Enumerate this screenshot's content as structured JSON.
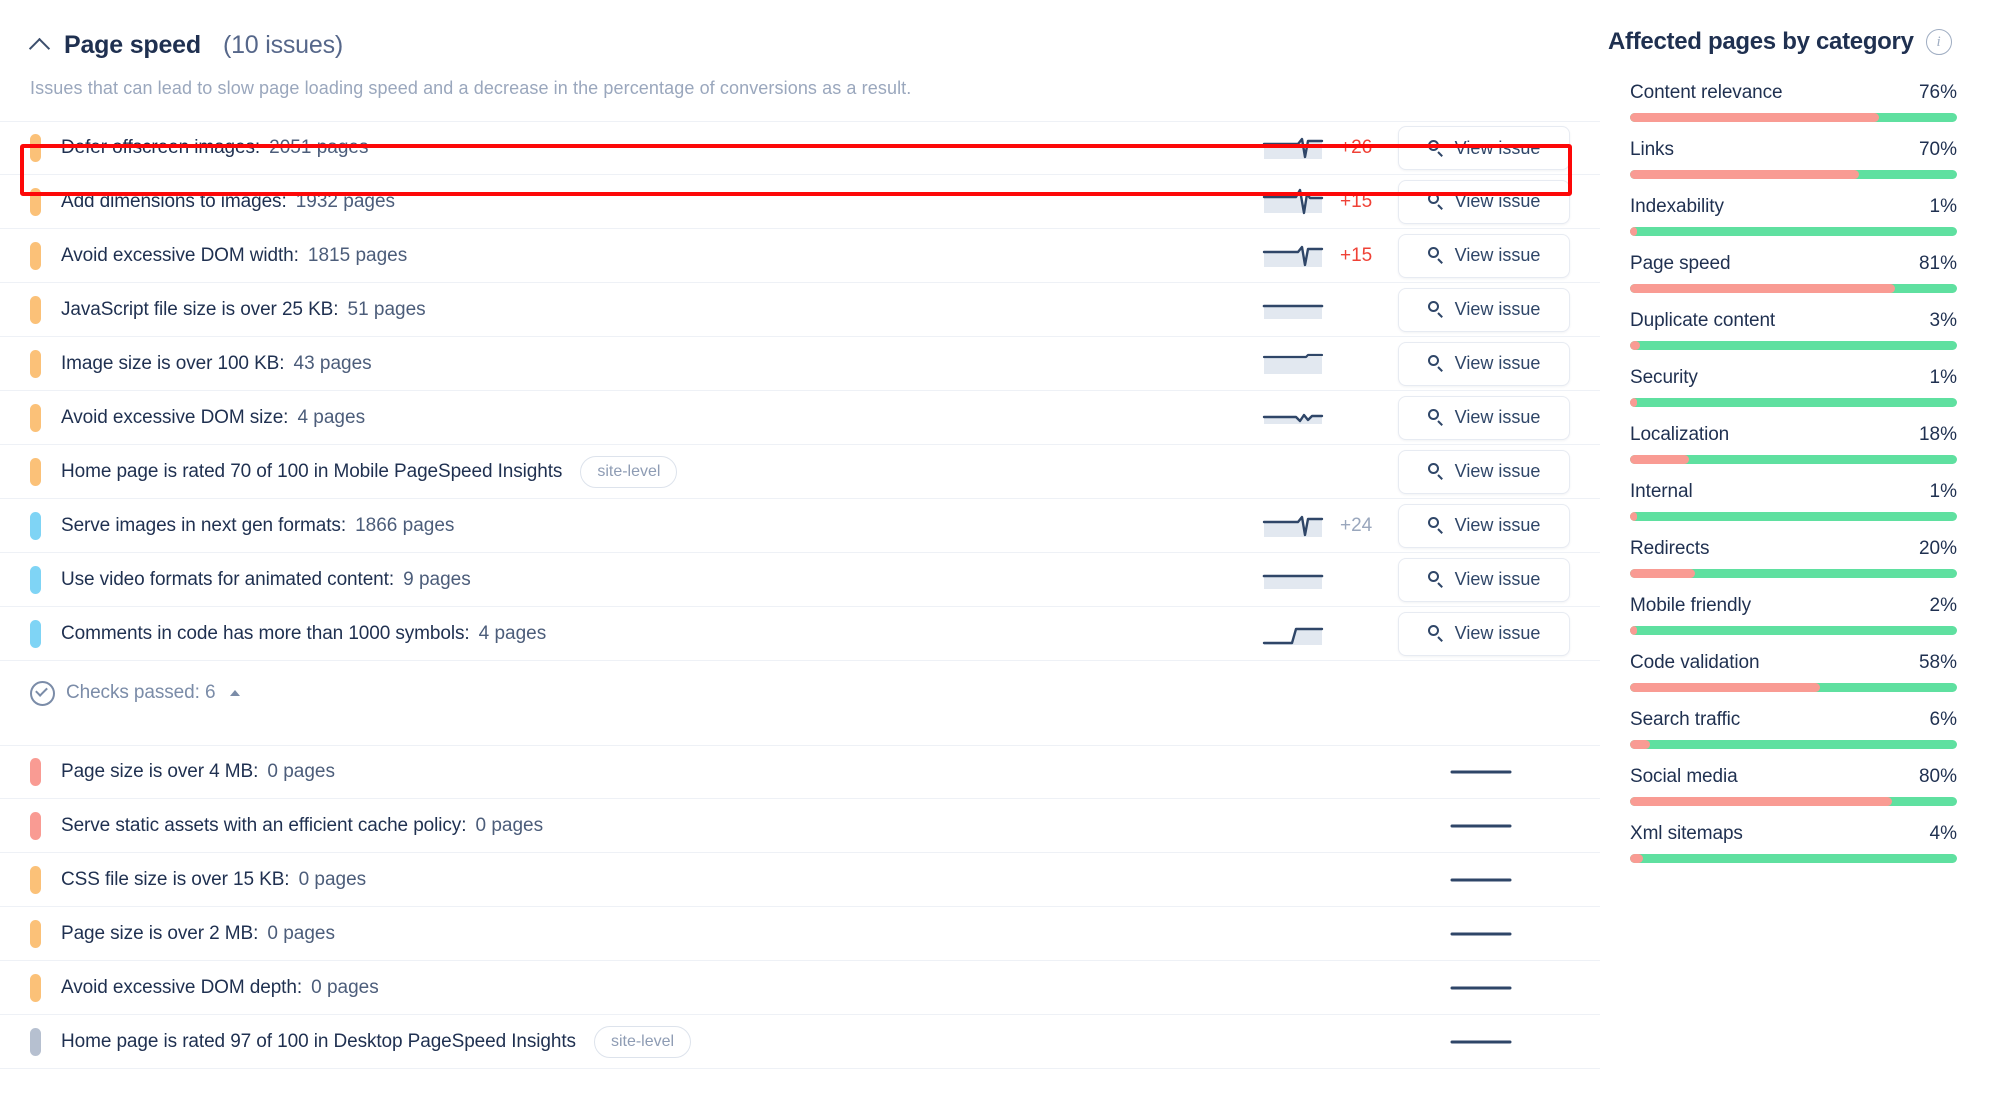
{
  "section": {
    "title": "Page speed",
    "count": "(10 issues)",
    "description": "Issues that can lead to slow page loading speed and a decrease in the percentage of conversions as a result.",
    "collapse_icon": "chevron-up-icon"
  },
  "view_issue_label": "View issue",
  "site_level_badge": "site-level",
  "issues": [
    {
      "severity": "warning",
      "label": "Defer offscreen images",
      "sep": ":",
      "count": "2051 pages",
      "badge": "",
      "spark": "dip",
      "delta": "+26",
      "delta_state": "up"
    },
    {
      "severity": "warning",
      "label": "Add dimensions to images",
      "sep": ":",
      "count": "1932 pages",
      "badge": "",
      "spark": "dip-tall",
      "delta": "+15",
      "delta_state": "up"
    },
    {
      "severity": "warning",
      "label": "Avoid excessive DOM width",
      "sep": ":",
      "count": "1815 pages",
      "badge": "",
      "spark": "dip",
      "delta": "+15",
      "delta_state": "up"
    },
    {
      "severity": "warning",
      "label": "JavaScript file size is over 25 KB",
      "sep": ":",
      "count": "51 pages",
      "badge": "",
      "spark": "flat-fill",
      "delta": "",
      "delta_state": ""
    },
    {
      "severity": "warning",
      "label": "Image size is over 100 KB",
      "sep": ":",
      "count": "43 pages",
      "badge": "",
      "spark": "block",
      "delta": "",
      "delta_state": ""
    },
    {
      "severity": "warning",
      "label": "Avoid excessive DOM size",
      "sep": ":",
      "count": "4 pages",
      "badge": "",
      "spark": "wave",
      "delta": "",
      "delta_state": ""
    },
    {
      "severity": "warning",
      "label": "Home page is rated 70 of 100 in Mobile PageSpeed Insights",
      "sep": "",
      "count": "",
      "badge": "site-level",
      "spark": "none",
      "delta": "",
      "delta_state": ""
    },
    {
      "severity": "notice",
      "label": "Serve images in next gen formats",
      "sep": ":",
      "count": "1866 pages",
      "badge": "",
      "spark": "dip",
      "delta": "+24",
      "delta_state": "flat"
    },
    {
      "severity": "notice",
      "label": "Use video formats for animated content",
      "sep": ":",
      "count": "9 pages",
      "badge": "",
      "spark": "flat-fill",
      "delta": "",
      "delta_state": ""
    },
    {
      "severity": "notice",
      "label": "Comments in code has more than 1000 symbols",
      "sep": ":",
      "count": "4 pages",
      "badge": "",
      "spark": "step",
      "delta": "",
      "delta_state": ""
    }
  ],
  "checks_passed": {
    "label": "Checks passed: 6",
    "icon": "check-circle-icon",
    "caret": "caret-up-icon",
    "items": [
      {
        "severity": "error",
        "label": "Page size is over 4 MB",
        "sep": ":",
        "count": "0 pages",
        "badge": ""
      },
      {
        "severity": "error",
        "label": "Serve static assets with an efficient cache policy",
        "sep": ":",
        "count": "0 pages",
        "badge": ""
      },
      {
        "severity": "warning",
        "label": "CSS file size is over 15 KB",
        "sep": ":",
        "count": "0 pages",
        "badge": ""
      },
      {
        "severity": "warning",
        "label": "Page size is over 2 MB",
        "sep": ":",
        "count": "0 pages",
        "badge": ""
      },
      {
        "severity": "warning",
        "label": "Avoid excessive DOM depth",
        "sep": ":",
        "count": "0 pages",
        "badge": ""
      },
      {
        "severity": "neutral",
        "label": "Home page is rated 97 of 100 in Desktop PageSpeed Insights",
        "sep": "",
        "count": "",
        "badge": "site-level"
      }
    ]
  },
  "affected": {
    "title": "Affected pages by category",
    "info_icon": "info-icon",
    "categories": [
      {
        "name": "Content relevance",
        "pct": "76%",
        "value": 76
      },
      {
        "name": "Links",
        "pct": "70%",
        "value": 70
      },
      {
        "name": "Indexability",
        "pct": "1%",
        "value": 1
      },
      {
        "name": "Page speed",
        "pct": "81%",
        "value": 81
      },
      {
        "name": "Duplicate content",
        "pct": "3%",
        "value": 3
      },
      {
        "name": "Security",
        "pct": "1%",
        "value": 1
      },
      {
        "name": "Localization",
        "pct": "18%",
        "value": 18
      },
      {
        "name": "Internal",
        "pct": "1%",
        "value": 1
      },
      {
        "name": "Redirects",
        "pct": "20%",
        "value": 20
      },
      {
        "name": "Mobile friendly",
        "pct": "2%",
        "value": 2
      },
      {
        "name": "Code validation",
        "pct": "58%",
        "value": 58
      },
      {
        "name": "Search traffic",
        "pct": "6%",
        "value": 6
      },
      {
        "name": "Social media",
        "pct": "80%",
        "value": 80
      },
      {
        "name": "Xml sitemaps",
        "pct": "4%",
        "value": 4
      }
    ]
  },
  "colors": {
    "severity_warning": "#fbc178",
    "severity_notice": "#7fd4f5",
    "severity_error": "#f99b93",
    "severity_neutral": "#b6c0d0",
    "delta_up": "#ef4136",
    "delta_flat": "#9aa7bd",
    "bar_bad": "#f99b93",
    "bar_good": "#5fe0a0",
    "highlight_border": "#fd0808"
  }
}
